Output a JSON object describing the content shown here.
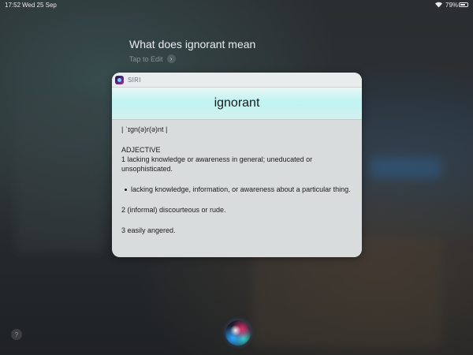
{
  "status_bar": {
    "time": "17:52",
    "date": "Wed 25 Sep",
    "battery": "79%",
    "battery_level": 0.79
  },
  "siri": {
    "query": "What does ignorant mean",
    "tap_to_edit": "Tap to Edit",
    "app_label": "SIRI"
  },
  "definition": {
    "word": "ignorant",
    "pronunciation": "| ˈɪɡn(ə)r(ə)nt |",
    "part_of_speech": "ADJECTIVE",
    "sense_1": "1  lacking knowledge or awareness in general; uneducated or unsophisticated.",
    "sub_sense_1": "lacking knowledge, information, or awareness about a particular thing.",
    "sense_2": "2  (informal)  discourteous or rude.",
    "sense_3": "3  easily angered."
  },
  "bottom": {
    "help_label": "?"
  }
}
